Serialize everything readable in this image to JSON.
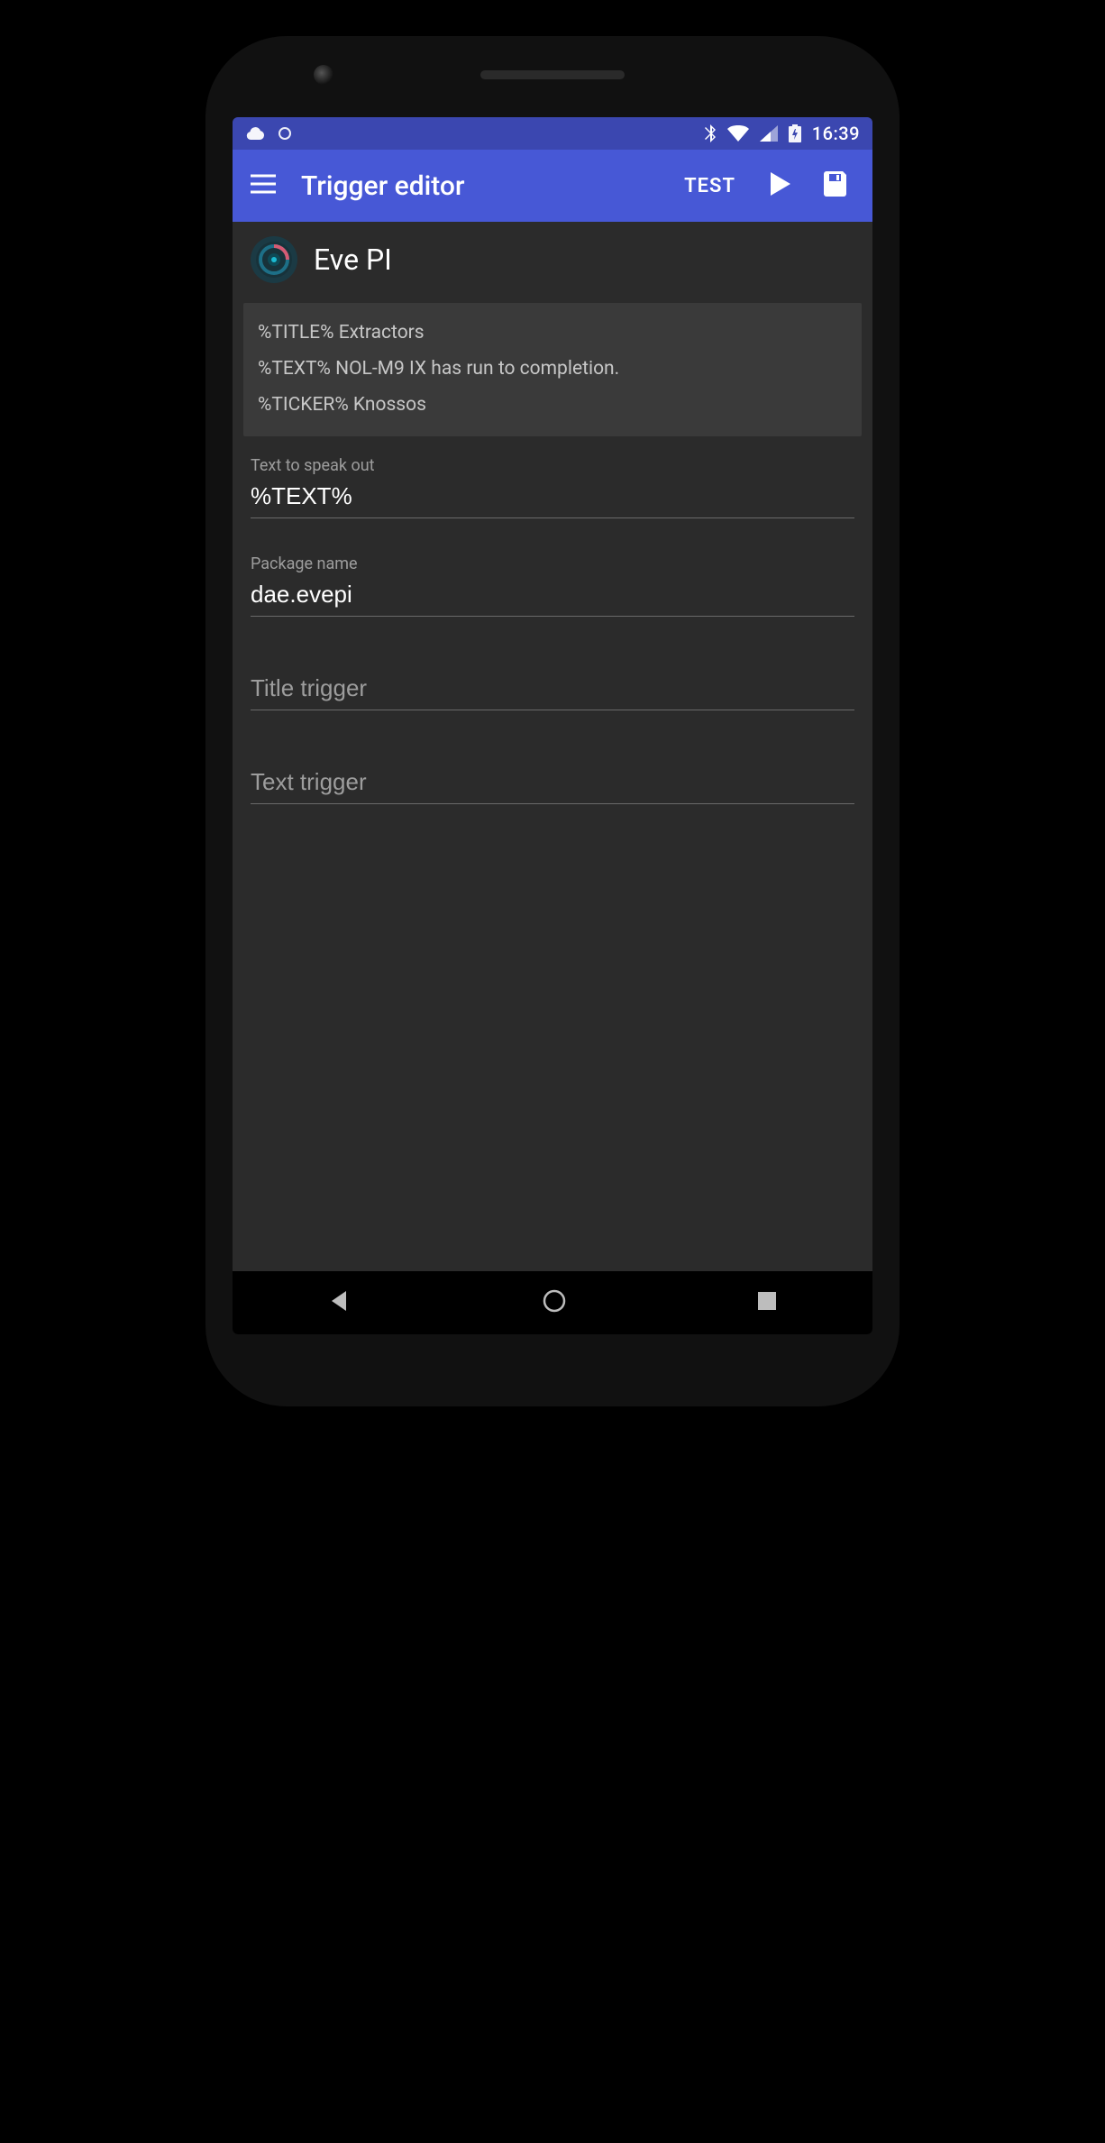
{
  "statusbar": {
    "time": "16:39",
    "icons": [
      "cloud",
      "circle",
      "bluetooth",
      "wifi",
      "cell",
      "battery"
    ]
  },
  "appbar": {
    "title": "Trigger editor",
    "test_label": "TEST"
  },
  "app": {
    "name": "Eve PI",
    "icon": "pi-target-icon"
  },
  "preview": {
    "title_line": "%TITLE% Extractors",
    "text_line": "%TEXT% NOL-M9 IX has run to completion.",
    "ticker_line": "%TICKER% Knossos"
  },
  "fields": {
    "speak": {
      "label": "Text to speak out",
      "value": "%TEXT%"
    },
    "package": {
      "label": "Package name",
      "value": "dae.evepi"
    },
    "title_trigger": {
      "placeholder": "Title trigger",
      "value": ""
    },
    "text_trigger": {
      "placeholder": "Text trigger",
      "value": ""
    }
  },
  "colors": {
    "primary": "#4758d6",
    "primary_dark": "#3b47b0",
    "bg": "#2b2b2b",
    "card": "#3a3a3a"
  }
}
